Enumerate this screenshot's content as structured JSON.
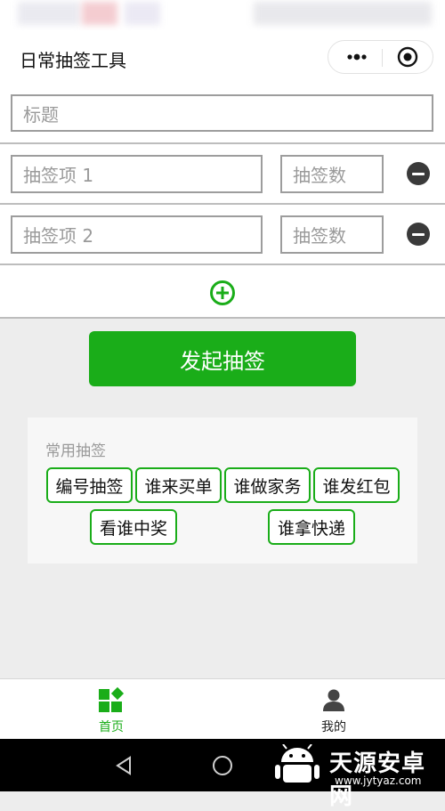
{
  "app": {
    "title": "日常抽签工具"
  },
  "form": {
    "title_placeholder": "标题",
    "items": [
      {
        "name_placeholder": "抽签项 1",
        "count_placeholder": "抽签数"
      },
      {
        "name_placeholder": "抽签项 2",
        "count_placeholder": "抽签数"
      }
    ]
  },
  "actions": {
    "start_label": "发起抽签"
  },
  "common": {
    "title": "常用抽签",
    "tags": [
      "编号抽签",
      "谁来买单",
      "谁做家务",
      "谁发红包",
      "看谁中奖",
      "谁拿快递"
    ]
  },
  "tabbar": {
    "tabs": [
      {
        "label": "首页",
        "icon": "grid-icon",
        "active": true
      },
      {
        "label": "我的",
        "icon": "user-icon",
        "active": false
      }
    ]
  },
  "watermark": {
    "main": "天源安卓网",
    "sub": "www.jytyaz.com"
  },
  "colors": {
    "accent": "#1aad19",
    "inactive": "#333333"
  }
}
